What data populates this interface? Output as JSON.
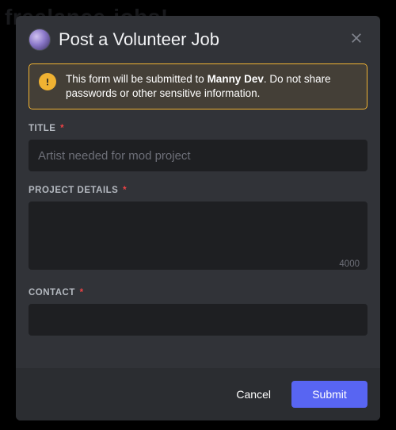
{
  "modal": {
    "title": "Post a Volunteer Job",
    "submitted_to": "Manny Dev"
  },
  "warning": {
    "prefix": "This form will be submitted to ",
    "suffix": ". Do not share passwords or other sensitive information."
  },
  "fields": {
    "title": {
      "label": "TITLE",
      "placeholder": "Artist needed for mod project",
      "value": ""
    },
    "details": {
      "label": "PROJECT DETAILS",
      "value": "",
      "char_limit": "4000"
    },
    "contact": {
      "label": "CONTACT",
      "value": ""
    }
  },
  "footer": {
    "cancel": "Cancel",
    "submit": "Submit"
  },
  "required_marker": "*"
}
